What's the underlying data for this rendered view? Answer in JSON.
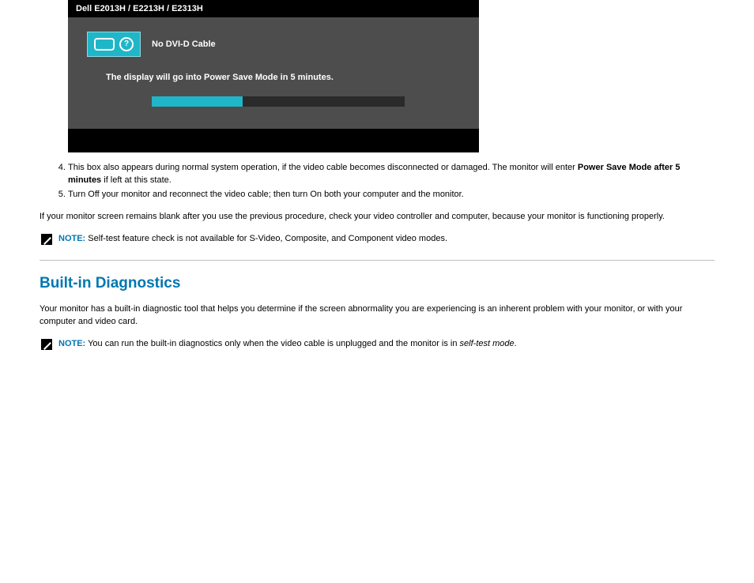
{
  "dialog": {
    "title": "Dell E2013H / E2213H / E2313H",
    "no_cable": "No DVI-D Cable",
    "power_save": "The display will go into Power Save Mode in 5 minutes."
  },
  "instructions": {
    "item4_a": "This box also appears during normal system operation, if the video cable becomes disconnected or damaged. The monitor will enter ",
    "item4_b": "Power Save Mode after 5 minutes",
    "item4_c": " if left at this state.",
    "item5": "Turn Off your monitor and reconnect the video cable; then turn On both your computer and the monitor."
  },
  "para_blank": "If your monitor screen remains blank after you use the previous procedure, check your video controller and computer, because your monitor is functioning properly.",
  "note1": {
    "label": "NOTE:",
    "text": " Self-test feature check is not available for S-Video, Composite, and Component video modes."
  },
  "heading_diag": "Built-in Diagnostics",
  "para_diag": "Your monitor has a built-in diagnostic tool that helps you determine if the screen abnormality you are experiencing is an inherent problem with your monitor, or with your computer and video card.",
  "note2": {
    "label": "NOTE:",
    "text_a": " You can run the built-in diagnostics only when the video cable is unplugged and the monitor is in ",
    "text_em": "self-test mode",
    "text_b": "."
  }
}
